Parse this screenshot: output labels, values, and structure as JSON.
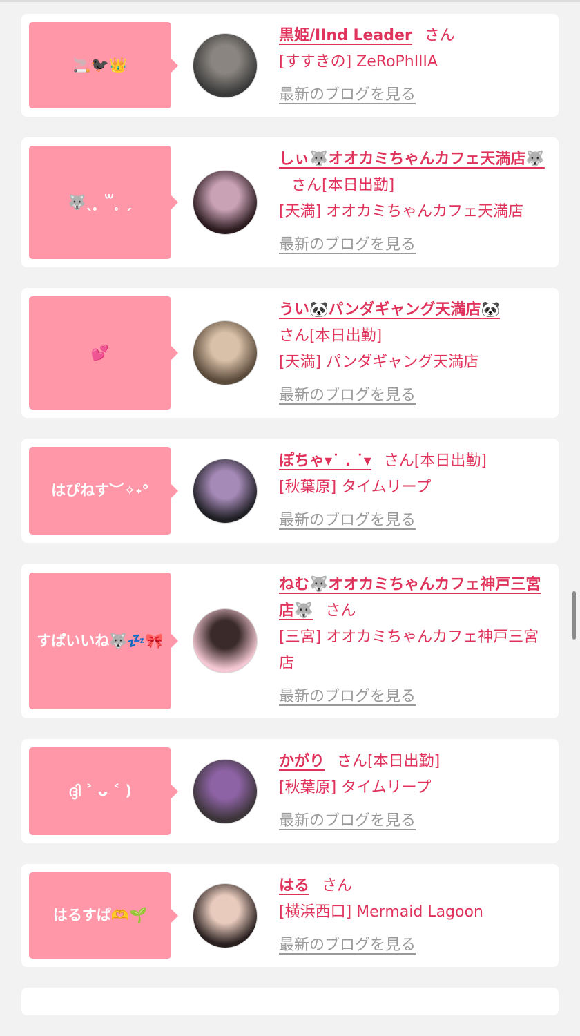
{
  "entries": [
    {
      "message": "🚬🐦‍⬛👑",
      "name": "黒姫/IInd Leader",
      "san": "さん",
      "status": "",
      "shop": "[すすきの] ZeRoPhIlIA",
      "blog": "最新のブログを見る",
      "avatar_colors": [
        "#3a3a3a",
        "#8a8580"
      ]
    },
    {
      "message": "🐺ˎ ̥ ꒳ ̥ ˏ",
      "name": "しぃ🐺オオカミちゃんカフェ天満店🐺",
      "san": "さん",
      "status": "[本日出勤]",
      "shop": "[天満] オオカミちゃんカフェ天満店",
      "blog": "最新のブログを見る",
      "avatar_colors": [
        "#2a1a1e",
        "#c9a2b5"
      ]
    },
    {
      "message": "💕",
      "name": "うい🐼パンダギャング天満店🐼",
      "san": "さん",
      "status": "[本日出勤]",
      "shop": "[天満] パンダギャング天満店",
      "blog": "最新のブログを見る",
      "avatar_colors": [
        "#5a4a3a",
        "#d9c0a8"
      ]
    },
    {
      "message": "はぴねす︶✧˖°",
      "name": "ぽちゃ▾˙ . ˙▾",
      "san": "さん",
      "status": "[本日出勤]",
      "shop": "[秋葉原] タイムリープ",
      "blog": "最新のブログを見る",
      "avatar_colors": [
        "#1f1f24",
        "#a58ab7"
      ]
    },
    {
      "message": "すぱいいね🐺💤🎀",
      "name": "ねむ🐺オオカミちゃんカフェ神戸三宮店🐺",
      "san": "さん",
      "status": "",
      "shop": "[三宮] オオカミちゃんカフェ神戸三宮店",
      "blog": "最新のブログを見る",
      "avatar_colors": [
        "#f3c7d3",
        "#3a2a2a"
      ]
    },
    {
      "message": "ദ്ദി ˃ ᴗ ˂ )",
      "name": "かがり",
      "san": "さん",
      "status": "[本日出勤]",
      "shop": "[秋葉原] タイムリープ",
      "blog": "最新のブログを見る",
      "avatar_colors": [
        "#3b3438",
        "#8e63a6"
      ]
    },
    {
      "message": "はるすぱ🫶🌱",
      "name": "はる",
      "san": "さん",
      "status": "",
      "shop": "[横浜西口] Mermaid Lagoon",
      "blog": "最新のブログを見る",
      "avatar_colors": [
        "#2a2020",
        "#e8cbbd"
      ]
    }
  ]
}
